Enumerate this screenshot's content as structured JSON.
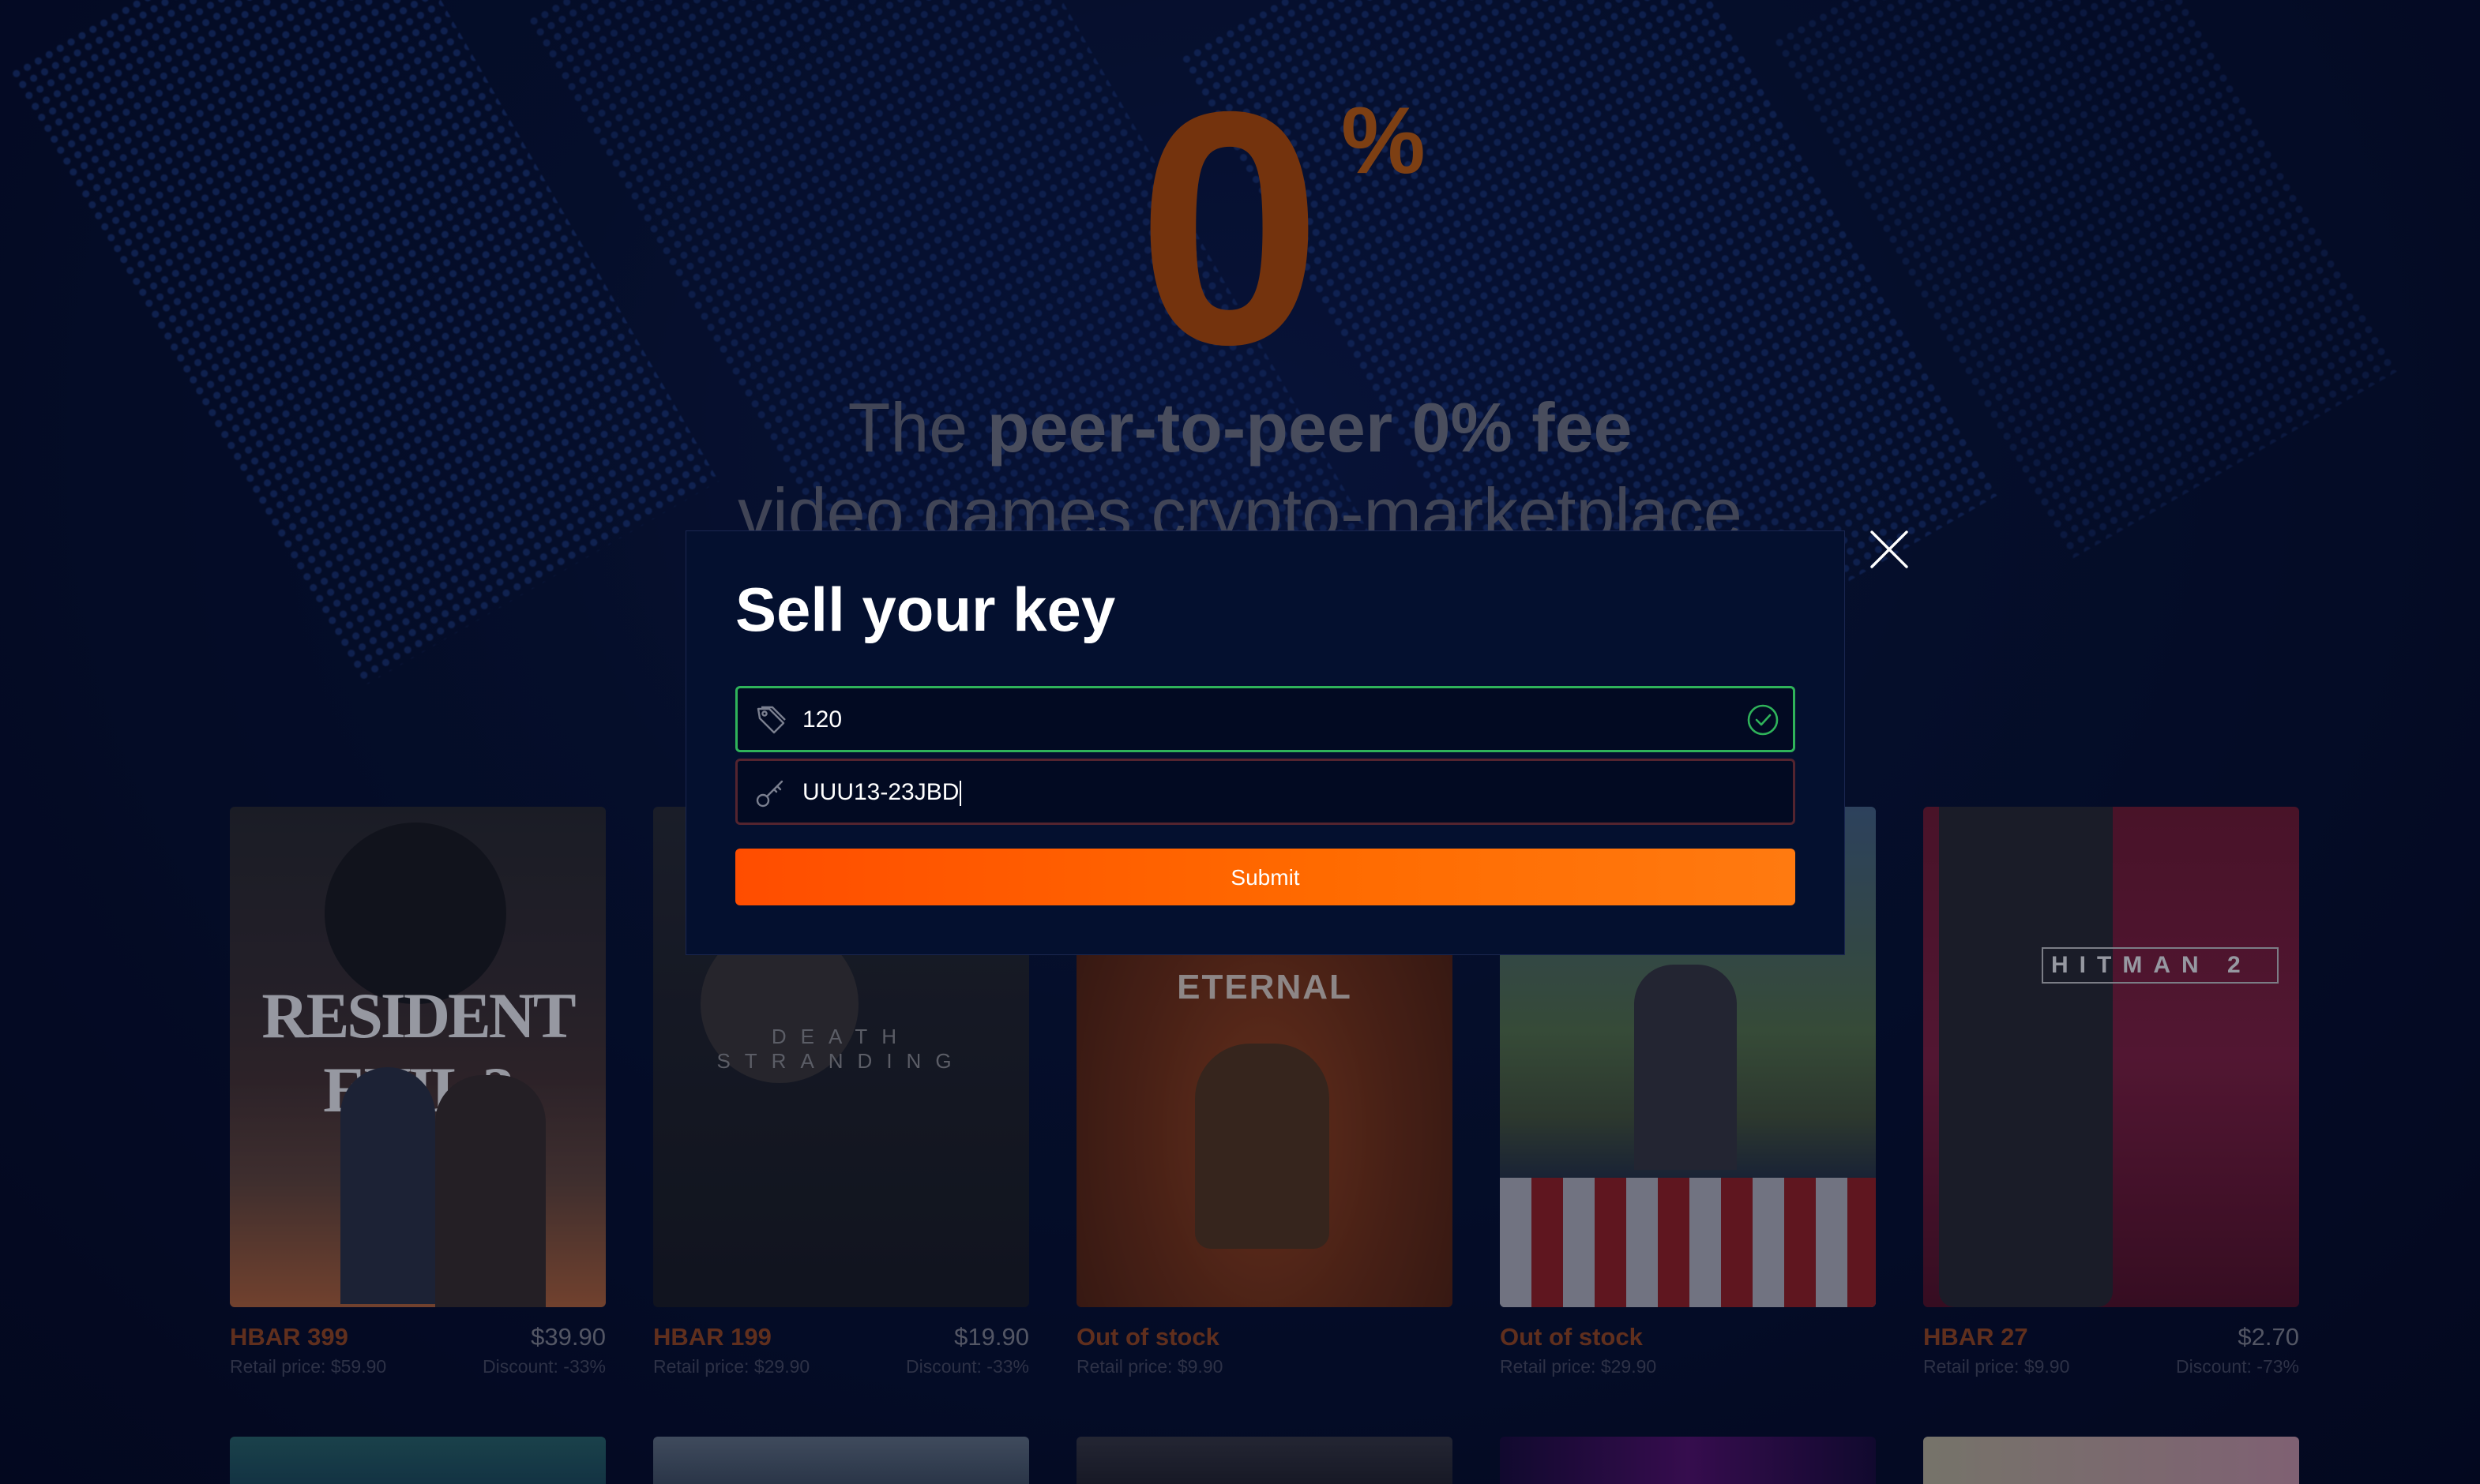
{
  "hero": {
    "zero": "0",
    "percent": "%",
    "line1_prefix": "The ",
    "line1_bold": "peer-to-peer 0% fee",
    "line2": "video games crypto-marketplace"
  },
  "modal": {
    "title": "Sell your key",
    "price_value": "120",
    "price_icon": "price-tag-icon",
    "key_value": "UUU13-23JBD",
    "key_icon": "key-icon",
    "valid_icon": "check-circle-icon",
    "submit_label": "Submit",
    "close_icon": "close-icon"
  },
  "games": [
    {
      "cover_title": "RESIDENT EVIL 3",
      "price_hbar": "HBAR 399",
      "price_usd": "$39.90",
      "retail": "Retail price: $59.90",
      "discount": "Discount: -33%"
    },
    {
      "cover_title": "DEATH STRANDING",
      "price_hbar": "HBAR 199",
      "price_usd": "$19.90",
      "retail": "Retail price: $29.90",
      "discount": "Discount: -33%"
    },
    {
      "cover_title": "ETERNAL",
      "price_hbar": "Out of stock",
      "price_usd": "",
      "retail": "Retail price: $9.90",
      "discount": ""
    },
    {
      "cover_title": "",
      "price_hbar": "Out of stock",
      "price_usd": "",
      "retail": "Retail price: $29.90",
      "discount": ""
    },
    {
      "cover_title": "HITMAN 2",
      "price_hbar": "HBAR 27",
      "price_usd": "$2.70",
      "retail": "Retail price: $9.90",
      "discount": "Discount: -73%"
    }
  ],
  "colors": {
    "accent": "#ff5a00",
    "valid_border": "#2fb35a",
    "modal_bg": "#04102f",
    "page_bg": "#050b22"
  }
}
